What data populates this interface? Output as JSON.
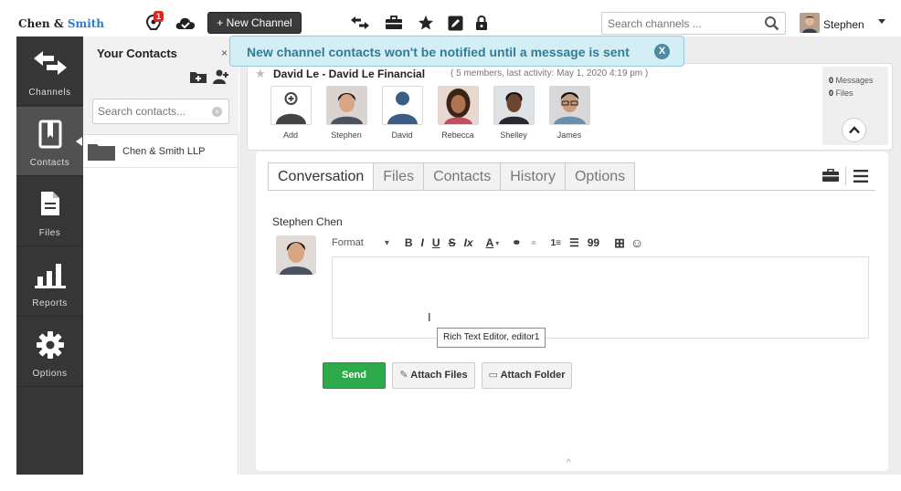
{
  "app": {
    "brand_part1": "Chen &",
    "brand_part2": "Smith",
    "accent_color": "#2b7bd1"
  },
  "topbar": {
    "notification_count": "1",
    "new_channel_label": "+ New Channel",
    "search_placeholder": "Search channels ...",
    "user_name": "Stephen",
    "icons": [
      "notifications-icon",
      "cloud-check-icon",
      "transfer-icon",
      "toolbox-icon",
      "star-icon",
      "edit-icon",
      "lock-icon",
      "search-icon"
    ]
  },
  "leftnav": {
    "items": [
      {
        "label": "Channels",
        "icon": "arrows-icon"
      },
      {
        "label": "Contacts",
        "icon": "address-book-icon",
        "active": true
      },
      {
        "label": "Files",
        "icon": "file-icon"
      },
      {
        "label": "Reports",
        "icon": "bar-chart-icon"
      },
      {
        "label": "Options",
        "icon": "gear-icon"
      }
    ]
  },
  "contacts": {
    "title": "Your Contacts",
    "close_glyph": "×",
    "search_placeholder": "Search contacts...",
    "folders": [
      {
        "label": "Chen & Smith LLP"
      }
    ]
  },
  "banner": {
    "text": "New channel contacts won't be notified until a message is sent",
    "close_glyph": "X"
  },
  "channel": {
    "name": "David Le - David Le Financial",
    "meta": "( 5 members, last activity: May 1, 2020 4:19 pm )",
    "members": [
      {
        "label": "Add"
      },
      {
        "label": "Stephen"
      },
      {
        "label": "David"
      },
      {
        "label": "Rebecca"
      },
      {
        "label": "Shelley"
      },
      {
        "label": "James"
      }
    ],
    "messages_count": "0",
    "messages_label": "Messages",
    "files_count": "0",
    "files_label": "Files"
  },
  "tabs": [
    {
      "label": "Conversation",
      "active": true
    },
    {
      "label": "Files"
    },
    {
      "label": "Contacts"
    },
    {
      "label": "History"
    },
    {
      "label": "Options"
    }
  ],
  "composer": {
    "author": "Stephen Chen",
    "format_label": "Format",
    "tooltip": "Rich Text Editor, editor1",
    "send_label": "Send",
    "attach_files_label": "Attach Files",
    "attach_folder_label": "Attach Folder",
    "toolbar": {
      "format_caret": "▾",
      "bold": "B",
      "italic": "I",
      "underline": "U",
      "strike": "S",
      "clear": "Ix",
      "text_color": "A",
      "text_color_caret": "▾",
      "link": "⚭",
      "unlink": "⚭",
      "numbered_list": "1≡",
      "bulleted_list": "☰",
      "quote": "99",
      "table": "⊞",
      "emoji": "☺"
    }
  }
}
